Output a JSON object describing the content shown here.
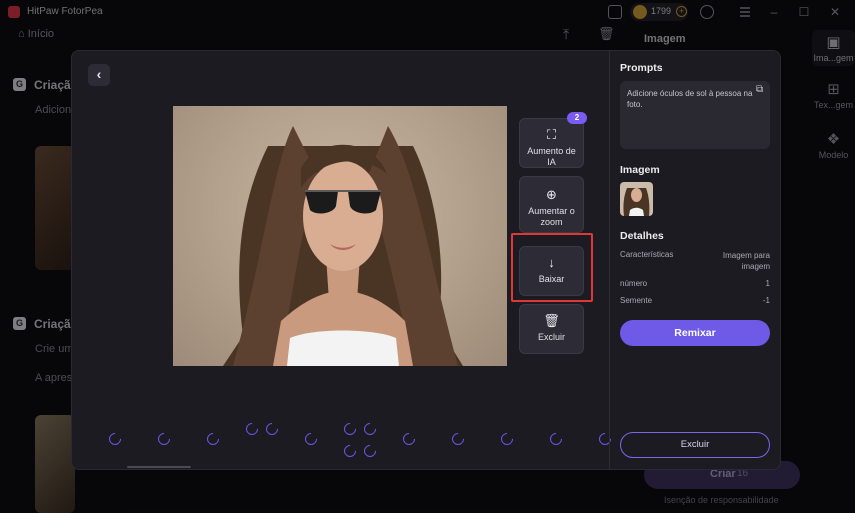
{
  "app": {
    "name": "HitPaw FotorPea",
    "credits": "1799",
    "add_credits": "+"
  },
  "window_controls": {
    "minimize": "–",
    "maximize": "☐",
    "close": "✕"
  },
  "nav": {
    "home_label": "Início"
  },
  "background": {
    "image_heading": "Imagem",
    "section1_title": "Criação",
    "section1_text": "Adicion",
    "section2_title": "Criação",
    "section2_text": "Crie um",
    "section2_sub": "A apres",
    "create_label": "Criar",
    "create_cost": "16",
    "disclaimer": "Isenção de responsabilidade"
  },
  "rail": {
    "items": [
      {
        "label": "Ima...gem",
        "icon": "image-icon"
      },
      {
        "label": "Tex...gem",
        "icon": "text-to-image-icon"
      },
      {
        "label": "Modelo",
        "icon": "model-icon"
      }
    ]
  },
  "modal": {
    "side_actions": [
      {
        "label": "Aumento de IA",
        "icon": "expand-icon"
      },
      {
        "label": "Aumentar o zoom",
        "icon": "zoom-in-icon"
      },
      {
        "label": "Baixar",
        "icon": "download-icon"
      },
      {
        "label": "Excluir",
        "icon": "trash-icon"
      }
    ],
    "ai_badge_count": "2",
    "panel": {
      "prompts_heading": "Prompts",
      "prompt_text": "Adicione óculos de sol à pessoa na foto.",
      "image_heading": "Imagem",
      "details_heading": "Detalhes",
      "details": [
        {
          "label": "Características",
          "value": "Imagem para imagem"
        },
        {
          "label": "número",
          "value": "1"
        },
        {
          "label": "Semente",
          "value": "-1"
        }
      ],
      "remix_label": "Remixar",
      "delete_label": "Excluir"
    }
  },
  "colors": {
    "accent": "#6f5ae8",
    "highlight_border": "#e0373b",
    "spinner": "#6e56e6"
  }
}
